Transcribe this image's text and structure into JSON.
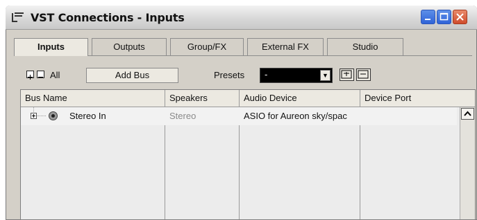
{
  "window": {
    "title": "VST Connections - Inputs"
  },
  "tabs": [
    {
      "label": "Inputs",
      "active": true
    },
    {
      "label": "Outputs"
    },
    {
      "label": "Group/FX"
    },
    {
      "label": "External FX"
    },
    {
      "label": "Studio"
    }
  ],
  "toolbar": {
    "all_label": "All",
    "add_bus_label": "Add Bus",
    "presets_label": "Presets",
    "presets_value": "-"
  },
  "table": {
    "columns": [
      "Bus Name",
      "Speakers",
      "Audio Device",
      "Device Port"
    ],
    "rows": [
      {
        "bus_name": "Stereo In",
        "speakers": "Stereo",
        "audio_device": "ASIO for Aureon sky/spac",
        "device_port": ""
      }
    ]
  },
  "colors": {
    "titlebar": "#d6d6d6",
    "minmax_button": "#2f63d8",
    "close_button": "#cf4b2c",
    "presets_bg": "#000000"
  }
}
